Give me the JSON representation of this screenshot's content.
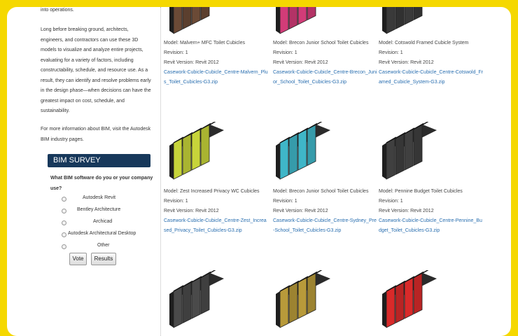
{
  "sidebar": {
    "intro_tail": "into operations.",
    "paragraph": "Long before breaking ground, architects, engineers, and contractors can use these 3D models to visualize and analyze entire projects, evaluating for a variety of factors, including constructability, schedule, and resource use. As a result, they can identify and resolve problems early in the design phase—when decisions can have the greatest impact on cost, schedule, and sustainability.",
    "info": "For more information about BIM, visit the Autodesk BIM industry pages."
  },
  "survey": {
    "title": "BIM SURVEY",
    "question": "What BIM software do you or your company use?",
    "options": [
      "Autodesk Revit",
      "Bentley Architecture",
      "Archicad",
      "Autodesk Architectural Desktop",
      "Other"
    ],
    "vote_label": "Vote",
    "results_label": "Results"
  },
  "products": [
    {
      "model": "Model: Malvern+ MFC Toilet Cubicles",
      "revision": "Revision: 1",
      "revit": "Revit Version: Revit 2012",
      "file": "Casework-Cubicle-Cubicle_Centre-Malvern_Plus_Toilet_Cubicles-G3.zip",
      "door_color": "#6b4a36"
    },
    {
      "model": "Model: Brecon Junior School Toilet Cubicles",
      "revision": "Revision: 1",
      "revit": "Revit Version: Revit 2012",
      "file": "Casework-Cubicle-Cubicle_Centre-Brecon_Junior_School_Toilet_Cubicles-G3.zip",
      "door_color": "#d23c78"
    },
    {
      "model": "Model: Cotswold Framed Cubicle System",
      "revision": "Revision: 1",
      "revit": "Revit Version: Revit 2012",
      "file": "Casework-Cubicle-Cubicle_Centre-Cotswold_Framed_Cubicle_System-G3.zip",
      "door_color": "#3a3a3a"
    },
    {
      "model": "Model: Zest Increased Privacy WC Cubicles",
      "revision": "Revision: 1",
      "revit": "Revit Version: Revit 2012",
      "file": "Casework-Cubicle-Cubicle_Centre-Zest_Increased_Privacy_Toilet_Cubicles-G3.zip",
      "door_color": "#c7d43a"
    },
    {
      "model": "Model: Brecon Junior School Toilet Cubicles",
      "revision": "Revision: 1",
      "revit": "Revit Version: Revit 2012",
      "file": "Casework-Cubicle-Cubicle_Centre-Sydney_Pre-School_Toilet_Cubicles-G3.zip",
      "door_color": "#3fb6c8"
    },
    {
      "model": "Model: Pennine Budget Toilet Cubicles",
      "revision": "Revision: 1",
      "revit": "Revit Version: Revit 2012",
      "file": "Casework-Cubicle-Cubicle_Centre-Pennine_Budget_Toilet_Cubicles-G3.zip",
      "door_color": "#404040"
    },
    {
      "door_color": "#4a4a4a"
    },
    {
      "door_color": "#b89a3a"
    },
    {
      "door_color": "#d92a2a"
    }
  ]
}
